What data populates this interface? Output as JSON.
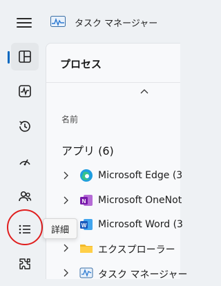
{
  "app": {
    "title": "タスク マネージャー"
  },
  "sidebar": {
    "items": [
      {
        "id": "processes",
        "icon": "processes-icon"
      },
      {
        "id": "performance",
        "icon": "performance-icon"
      },
      {
        "id": "app-history",
        "icon": "app-history-icon"
      },
      {
        "id": "startup",
        "icon": "startup-icon"
      },
      {
        "id": "users",
        "icon": "users-icon"
      },
      {
        "id": "details",
        "icon": "details-icon"
      },
      {
        "id": "services",
        "icon": "services-icon"
      }
    ],
    "selected": "processes",
    "tooltip": "詳細"
  },
  "main": {
    "title": "プロセス",
    "column_name": "名前",
    "group_label": "アプリ (6)",
    "processes": [
      {
        "name": "Microsoft Edge (3",
        "icon": "edge-icon"
      },
      {
        "name": "Microsoft OneNot",
        "icon": "onenote-icon"
      },
      {
        "name": "Microsoft Word (3",
        "icon": "word-icon"
      },
      {
        "name": "エクスプローラー",
        "icon": "explorer-icon"
      },
      {
        "name": "タスク マネージャー",
        "icon": "task-manager-icon"
      }
    ]
  },
  "colors": {
    "accent": "#0067c0",
    "highlight_circle": "#e01e1e"
  }
}
